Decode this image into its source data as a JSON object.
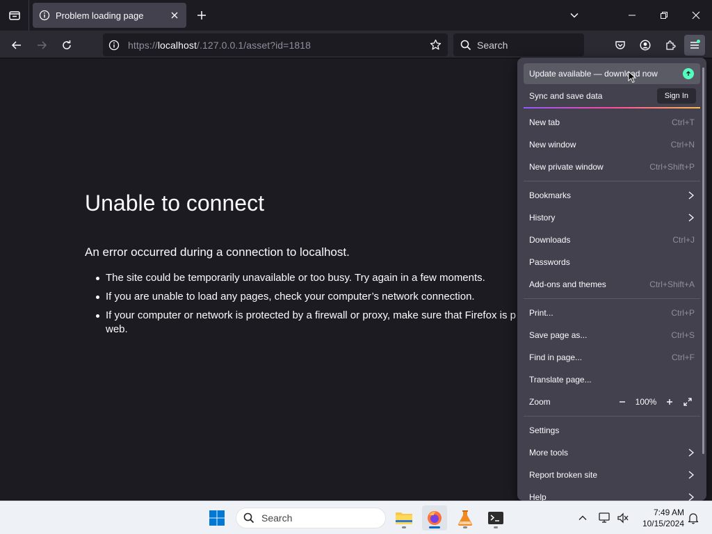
{
  "browser": {
    "tab": {
      "title": "Problem loading page"
    },
    "url": {
      "prefix": "https://",
      "host": "localhost",
      "rest": "/.127.0.0.1/asset?id=1818"
    },
    "search": {
      "placeholder": "Search"
    }
  },
  "page": {
    "title": "Unable to connect",
    "description": "An error occurred during a connection to localhost.",
    "bullets": [
      "The site could be temporarily unavailable or too busy. Try again in a few moments.",
      "If you are unable to load any pages, check your computer’s network connection.",
      "If your computer or network is protected by a firewall or proxy, make sure that Firefox is p web."
    ]
  },
  "menu": {
    "update_banner": "Update available — download now",
    "sync_label": "Sync and save data",
    "sign_in": "Sign In",
    "items": [
      {
        "label": "New tab",
        "shortcut": "Ctrl+T"
      },
      {
        "label": "New window",
        "shortcut": "Ctrl+N"
      },
      {
        "label": "New private window",
        "shortcut": "Ctrl+Shift+P"
      },
      {
        "label": "Bookmarks",
        "shortcut": ""
      },
      {
        "label": "History",
        "shortcut": ""
      },
      {
        "label": "Downloads",
        "shortcut": "Ctrl+J"
      },
      {
        "label": "Passwords",
        "shortcut": ""
      },
      {
        "label": "Add-ons and themes",
        "shortcut": "Ctrl+Shift+A"
      },
      {
        "label": "Print...",
        "shortcut": "Ctrl+P"
      },
      {
        "label": "Save page as...",
        "shortcut": "Ctrl+S"
      },
      {
        "label": "Find in page...",
        "shortcut": "Ctrl+F"
      },
      {
        "label": "Translate page...",
        "shortcut": ""
      },
      {
        "label": "Zoom",
        "shortcut": ""
      },
      {
        "label": "Settings",
        "shortcut": ""
      },
      {
        "label": "More tools",
        "shortcut": ""
      },
      {
        "label": "Report broken site",
        "shortcut": ""
      },
      {
        "label": "Help",
        "shortcut": ""
      }
    ],
    "zoom_value": "100%"
  },
  "taskbar": {
    "search_label": "Search",
    "time": "7:49 AM",
    "date": "10/15/2024"
  },
  "colors": {
    "accent": "#0067c0",
    "update_dot": "#54ffbd",
    "menu_bg": "#42414d",
    "page_bg": "#1c1b22"
  }
}
